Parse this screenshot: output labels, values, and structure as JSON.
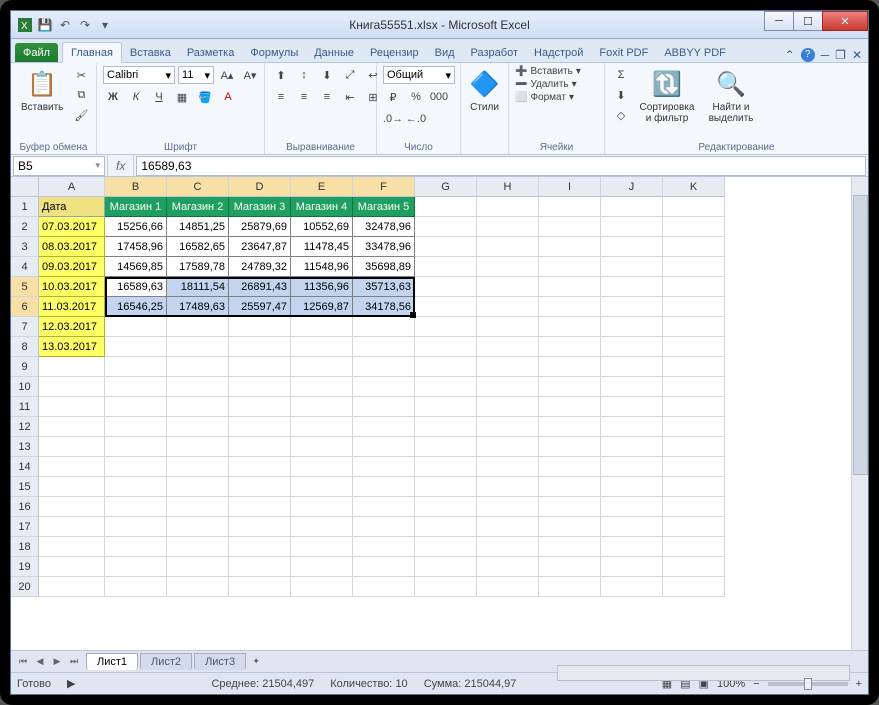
{
  "title": "Книга55551.xlsx - Microsoft Excel",
  "qat": {
    "excel": "X",
    "save": "💾",
    "undo": "↶",
    "redo": "↷"
  },
  "tabs": {
    "file": "Файл",
    "home": "Главная",
    "insert": "Вставка",
    "layout": "Разметка",
    "formulas": "Формулы",
    "data": "Данные",
    "review": "Рецензир",
    "view": "Вид",
    "developer": "Разработ",
    "addins": "Надстрой",
    "foxit": "Foxit PDF",
    "abbyy": "ABBYY PDF"
  },
  "ribbon": {
    "clipboard": {
      "paste": "Вставить",
      "label": "Буфер обмена"
    },
    "font": {
      "name": "Calibri",
      "size": "11",
      "label": "Шрифт",
      "bold": "Ж",
      "italic": "К",
      "underline": "Ч"
    },
    "align": {
      "label": "Выравнивание"
    },
    "number": {
      "format": "Общий",
      "label": "Число"
    },
    "styles": {
      "btn": "Стили",
      "label": ""
    },
    "cells": {
      "insert": "Вставить",
      "delete": "Удалить",
      "format": "Формат",
      "label": "Ячейки"
    },
    "editing": {
      "sort": "Сортировка и фильтр",
      "find": "Найти и выделить",
      "label": "Редактирование"
    }
  },
  "name_box": "B5",
  "formula": "16589,63",
  "col_letters": [
    "A",
    "B",
    "C",
    "D",
    "E",
    "F",
    "G",
    "H",
    "I",
    "J",
    "K"
  ],
  "row_nums": [
    "1",
    "2",
    "3",
    "4",
    "5",
    "6",
    "7",
    "8",
    "9",
    "10",
    "11",
    "12",
    "13",
    "14",
    "15",
    "16",
    "17",
    "18",
    "19",
    "20"
  ],
  "headers": {
    "date": "Дата",
    "shops": [
      "Магазин 1",
      "Магазин 2",
      "Магазин 3",
      "Магазин 4",
      "Магазин 5"
    ]
  },
  "rows": [
    {
      "date": "07.03.2017",
      "v": [
        "15256,66",
        "14851,25",
        "25879,69",
        "10552,69",
        "32478,96"
      ]
    },
    {
      "date": "08.03.2017",
      "v": [
        "17458,96",
        "16582,65",
        "23647,87",
        "11478,45",
        "33478,96"
      ]
    },
    {
      "date": "09.03.2017",
      "v": [
        "14569,85",
        "17589,78",
        "24789,32",
        "11548,96",
        "35698,89"
      ]
    },
    {
      "date": "10.03.2017",
      "v": [
        "16589,63",
        "18111,54",
        "26891,43",
        "11356,96",
        "35713,63"
      ]
    },
    {
      "date": "11.03.2017",
      "v": [
        "16546,25",
        "17489,63",
        "25597,47",
        "12569,87",
        "34178,56"
      ]
    },
    {
      "date": "12.03.2017",
      "v": [
        "",
        "",
        "",
        "",
        ""
      ]
    },
    {
      "date": "13.03.2017",
      "v": [
        "",
        "",
        "",
        "",
        ""
      ]
    }
  ],
  "sheets": {
    "s1": "Лист1",
    "s2": "Лист2",
    "s3": "Лист3"
  },
  "status": {
    "ready": "Готово",
    "avg_label": "Среднее:",
    "avg": "21504,497",
    "count_label": "Количество:",
    "count": "10",
    "sum_label": "Сумма:",
    "sum": "215044,97",
    "zoom": "100%"
  }
}
